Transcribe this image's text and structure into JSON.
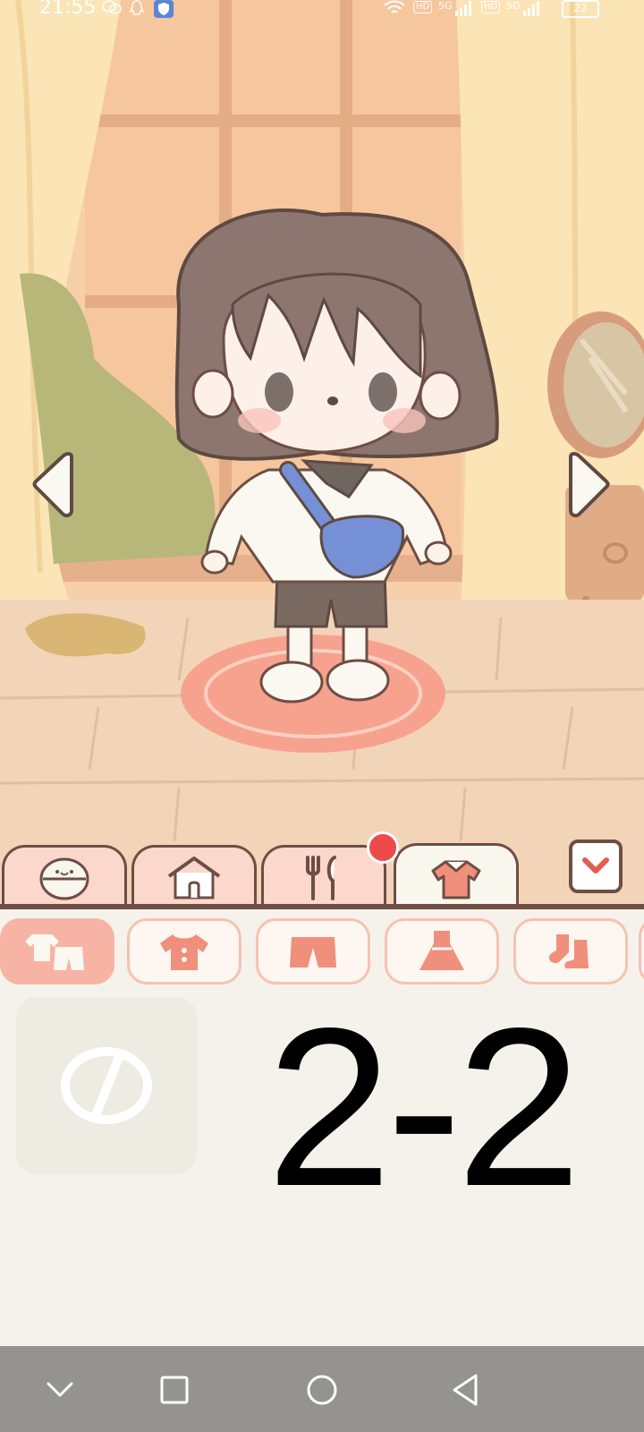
{
  "status_bar": {
    "time": "21:55",
    "network_badge_1": "HD",
    "network_type_1": "5G",
    "network_badge_2": "HD",
    "network_type_2": "5G",
    "battery": "22",
    "icons": [
      "wechat-icon",
      "qq-icon",
      "shield-app-icon",
      "wifi-icon",
      "signal-icon",
      "battery-icon"
    ]
  },
  "scene": {
    "nav_arrows": [
      "arrow-left-icon",
      "arrow-right-icon"
    ]
  },
  "tabs": [
    {
      "icon": "face-icon",
      "active": false
    },
    {
      "icon": "house-icon",
      "active": false
    },
    {
      "icon": "utensils-icon",
      "active": false,
      "notification": true
    },
    {
      "icon": "shirt-icon",
      "active": true
    }
  ],
  "collapse_icon": "chevron-down-icon",
  "categories": [
    {
      "icon": "outfit-set-icon",
      "active": true
    },
    {
      "icon": "top-icon",
      "active": false
    },
    {
      "icon": "shorts-icon",
      "active": false
    },
    {
      "icon": "dress-icon",
      "active": false
    },
    {
      "icon": "socks-icon",
      "active": false
    }
  ],
  "items": {
    "none_item_icon": "no-item-icon",
    "overlay_text": "2-2"
  },
  "colors": {
    "tab_fill": "#fcd8cc",
    "outline_brown": "#6e4e44",
    "accent_salmon": "#f08f7c",
    "notification_red": "#ee4a4a",
    "panel_bg": "#f5f2ec",
    "navbar_bg": "#949391"
  },
  "navbar": {
    "buttons": [
      "back-chevron-icon",
      "recent-apps-icon",
      "home-icon",
      "back-icon"
    ]
  }
}
